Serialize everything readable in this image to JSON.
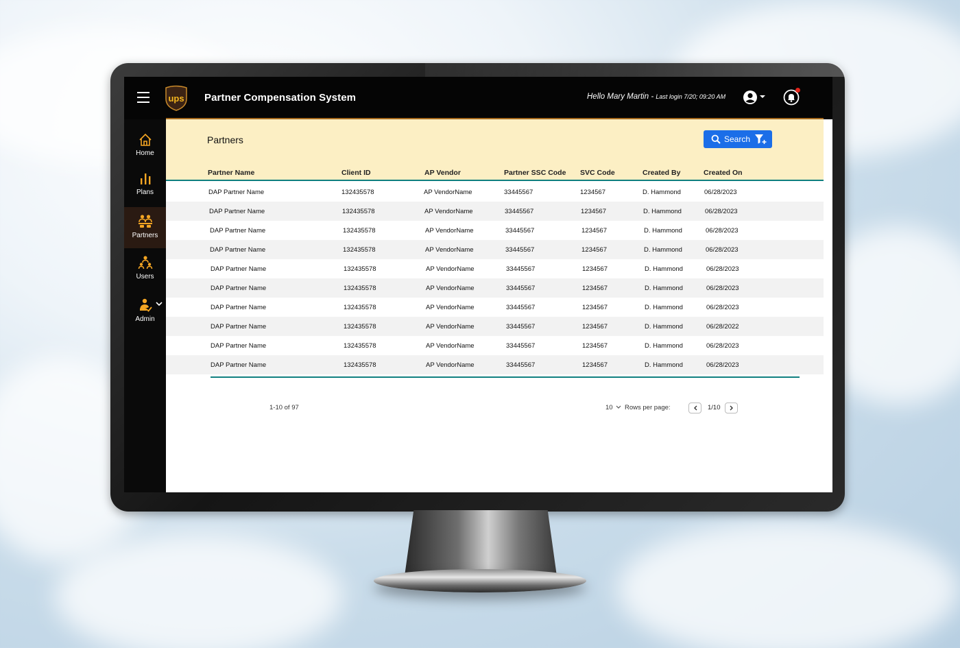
{
  "header": {
    "app_title": "Partner Compensation System",
    "greeting": "Hello Mary Martin",
    "separator": "-",
    "last_login": "Last login 7/20; 09:20 AM"
  },
  "sidebar": {
    "items": [
      {
        "label": "Home",
        "icon": "home-icon"
      },
      {
        "label": "Plans",
        "icon": "bar-chart-icon"
      },
      {
        "label": "Partners",
        "icon": "partners-icon",
        "active": true
      },
      {
        "label": "Users",
        "icon": "users-icon"
      },
      {
        "label": "Admin",
        "icon": "admin-icon"
      }
    ]
  },
  "page": {
    "title": "Partners",
    "search_label": "Search"
  },
  "table": {
    "columns": [
      "Partner Name",
      "Client ID",
      "AP Vendor",
      "Partner SSC Code",
      "SVC Code",
      "Created By",
      "Created On"
    ],
    "rows": [
      [
        "DAP Partner Name",
        "132435578",
        "AP VendorName",
        "33445567",
        "1234567",
        "D. Hammond",
        "06/28/2023"
      ],
      [
        "DAP Partner Name",
        "132435578",
        "AP VendorName",
        "33445567",
        "1234567",
        "D. Hammond",
        "06/28/2023"
      ],
      [
        "DAP Partner Name",
        "132435578",
        "AP VendorName",
        "33445567",
        "1234567",
        "D. Hammond",
        "06/28/2023"
      ],
      [
        "DAP Partner Name",
        "132435578",
        "AP VendorName",
        "33445567",
        "1234567",
        "D. Hammond",
        "06/28/2023"
      ],
      [
        "DAP Partner Name",
        "132435578",
        "AP VendorName",
        "33445567",
        "1234567",
        "D. Hammond",
        "06/28/2023"
      ],
      [
        "DAP Partner Name",
        "132435578",
        "AP VendorName",
        "33445567",
        "1234567",
        "D. Hammond",
        "06/28/2023"
      ],
      [
        "DAP Partner Name",
        "132435578",
        "AP VendorName",
        "33445567",
        "1234567",
        "D. Hammond",
        "06/28/2023"
      ],
      [
        "DAP Partner Name",
        "132435578",
        "AP VendorName",
        "33445567",
        "1234567",
        "D. Hammond",
        "06/28/2022"
      ],
      [
        "DAP Partner Name",
        "132435578",
        "AP VendorName",
        "33445567",
        "1234567",
        "D. Hammond",
        "06/28/2023"
      ],
      [
        "DAP Partner Name",
        "132435578",
        "AP VendorName",
        "33445567",
        "1234567",
        "D. Hammond",
        "06/28/2023"
      ]
    ]
  },
  "pagination": {
    "range": "1-10 of 97",
    "rows_per_page_value": "10",
    "rows_per_page_label": "Rows per page:",
    "page": "1/10"
  },
  "colors": {
    "topbar": "#050505",
    "accent_gold": "#f5a623",
    "header_band": "#fcefc4",
    "teal_rule": "#0f7f7f",
    "search_button": "#1b6ee8",
    "notification_dot": "#e2231a"
  }
}
